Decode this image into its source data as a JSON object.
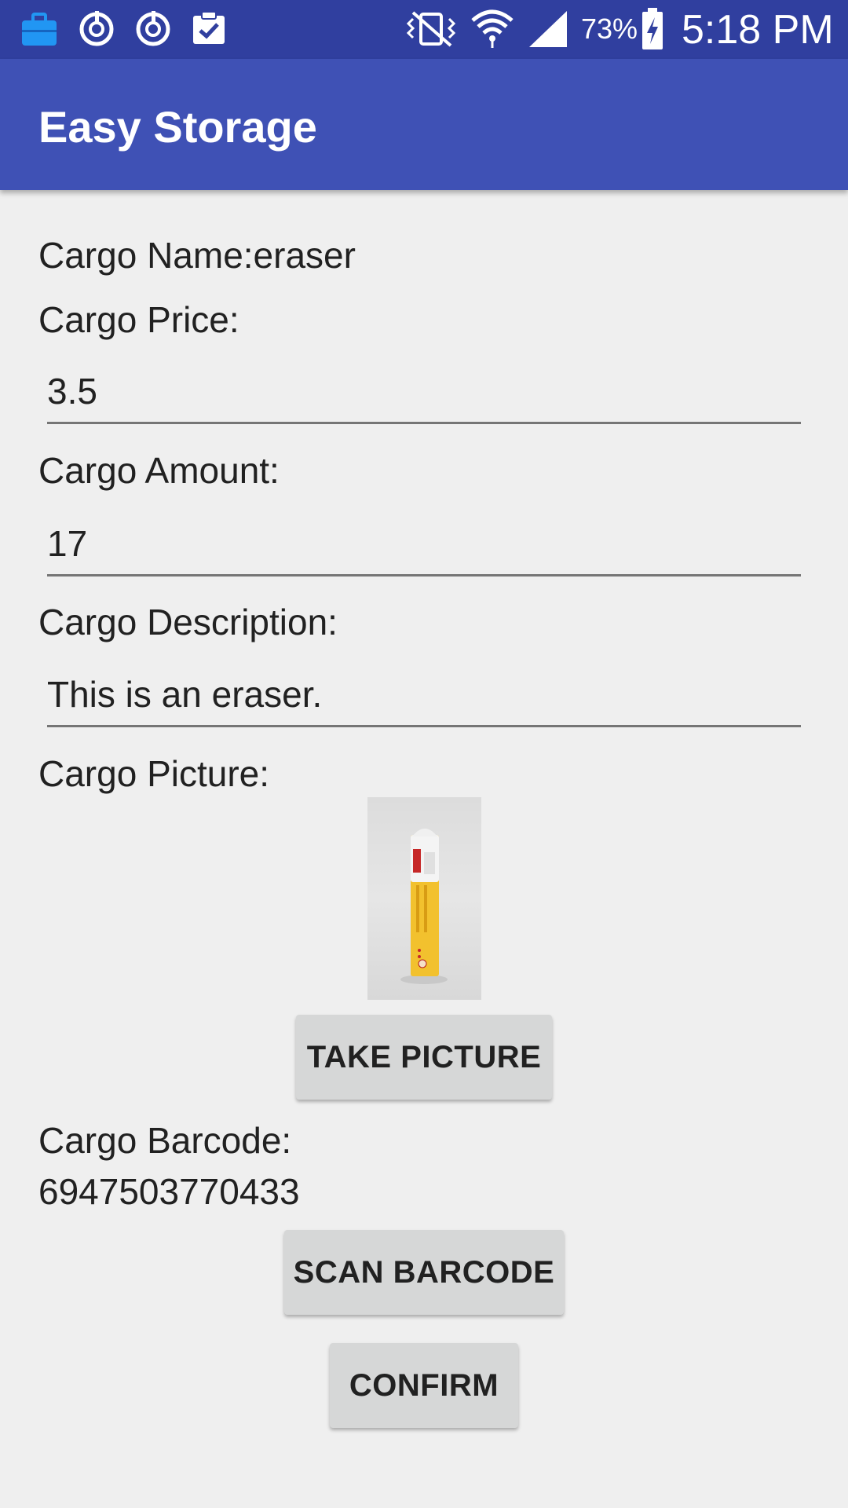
{
  "status_bar": {
    "icons": [
      "briefcase-icon",
      "sync-icon",
      "sync-icon",
      "clipboard-check-icon",
      "vibrate-mute-icon",
      "wifi-icon",
      "signal-icon",
      "battery-charging-icon"
    ],
    "battery": "73%",
    "time": "5:18 PM"
  },
  "app_bar": {
    "title": "Easy Storage"
  },
  "form": {
    "name_label": "Cargo Name:eraser",
    "price_label": "Cargo Price:",
    "price_value": "3.5",
    "amount_label": "Cargo Amount:",
    "amount_value": "17",
    "description_label": "Cargo Description:",
    "description_value": "This is an eraser.",
    "picture_label": "Cargo Picture:",
    "take_picture_button": "TAKE PICTURE",
    "barcode_label": "Cargo Barcode:",
    "barcode_value": "6947503770433",
    "scan_barcode_button": "SCAN BARCODE",
    "confirm_button": "CONFIRM"
  },
  "colors": {
    "status_bar": "#303f9f",
    "app_bar": "#3f51b5",
    "background": "#efefef",
    "button": "#d6d7d7",
    "eraser": "#f2c12e"
  }
}
